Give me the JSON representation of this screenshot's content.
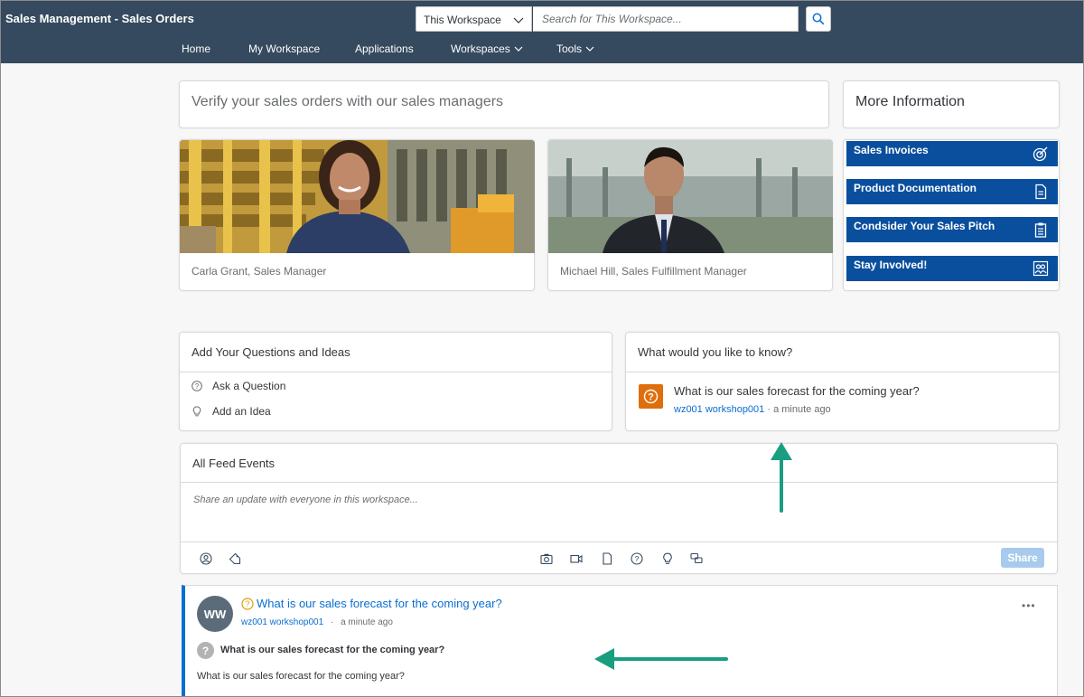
{
  "header": {
    "title": "Sales Management - Sales Orders",
    "scope": "This Workspace",
    "search_placeholder": "Search for This Workspace...",
    "nav": [
      "Home",
      "My Workspace",
      "Applications",
      "Workspaces",
      "Tools"
    ]
  },
  "verify": {
    "title": "Verify your sales orders with our sales managers"
  },
  "people": [
    {
      "caption": "Carla Grant, Sales Manager"
    },
    {
      "caption": "Michael Hill, Sales Fulfillment Manager"
    }
  ],
  "more_info": {
    "title": "More Information",
    "links": [
      {
        "label": "Sales Invoices",
        "icon": "target-icon"
      },
      {
        "label": "Product Documentation",
        "icon": "document-icon"
      },
      {
        "label": "Condsider Your Sales Pitch",
        "icon": "clipboard-icon"
      },
      {
        "label": "Stay Involved!",
        "icon": "group-icon"
      }
    ]
  },
  "questions": {
    "title": "Add Your Questions and Ideas",
    "ask": "Ask a Question",
    "idea": "Add an Idea"
  },
  "know": {
    "title": "What would you like to know?",
    "question": "What is our sales forecast for the coming year?",
    "author": "wz001 workshop001",
    "sep": " · ",
    "time": "a minute ago"
  },
  "feed": {
    "title": "All Feed Events",
    "placeholder": "Share an update with everyone in this workspace...",
    "share": "Share"
  },
  "post": {
    "avatar": "WW",
    "title": "What is our sales forecast for the coming year?",
    "author": "wz001 workshop001",
    "sep": "·",
    "time": "a minute ago",
    "question_title": "What is our sales forecast for the coming year?",
    "body": "What is our sales forecast for the coming year?",
    "more": "•••"
  },
  "colors": {
    "header_bg": "#354a5f",
    "tile_blue": "#0a4f9e",
    "link_blue": "#0a6ed1",
    "question_orange": "#df6e0c",
    "arrow_green": "#1a9e80"
  }
}
